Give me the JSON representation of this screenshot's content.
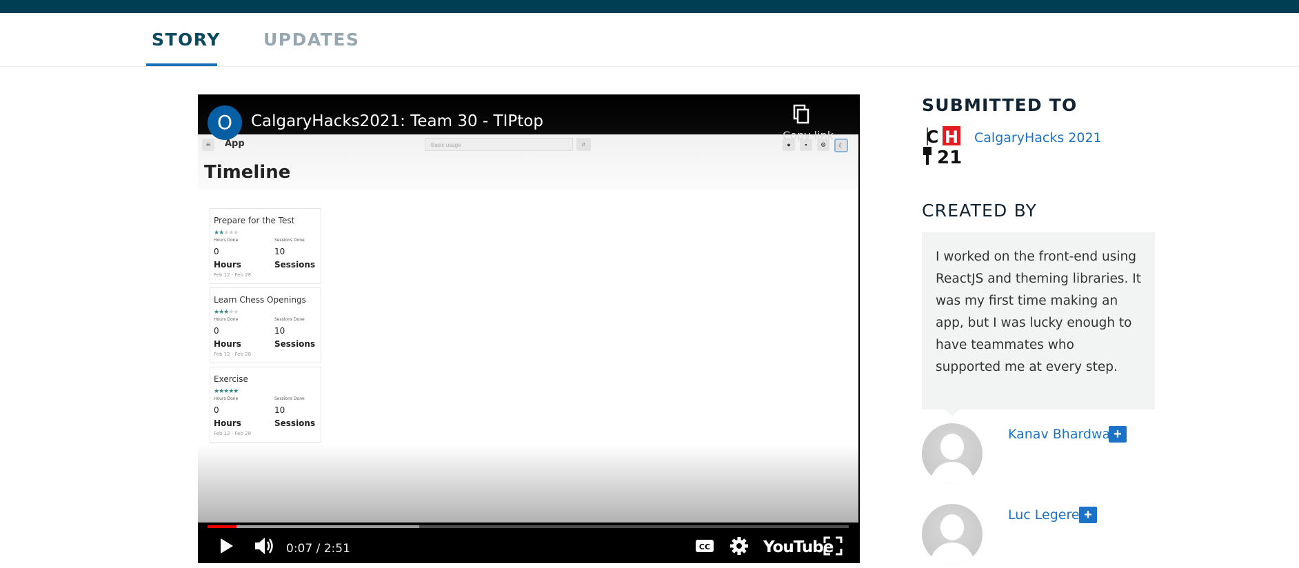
{
  "tabs": [
    {
      "label": "STORY",
      "active": true
    },
    {
      "label": "UPDATES",
      "active": false
    }
  ],
  "video": {
    "channel_initial": "O",
    "title": "CalgaryHacks2021: Team 30 - TIPtop",
    "copy_link_label": "Copy link",
    "time_display": "0:07 / 2:51",
    "progress_played_fraction": 0.045,
    "progress_buffered_fraction": 0.33,
    "brand_label": "YouTube",
    "preview": {
      "app_name": "App",
      "search_placeholder": "Basic usage",
      "page_title": "Timeline",
      "cards": [
        {
          "title": "Prepare for the Test",
          "stars": 2,
          "hours_label": "Hours Done",
          "sessions_label": "Sessions Done",
          "hours": "0",
          "sessions": "10",
          "hours_unit": "Hours",
          "sessions_unit": "Sessions",
          "dates": "Feb 12 - Feb 28"
        },
        {
          "title": "Learn Chess Openings",
          "stars": 3,
          "hours_label": "Hours Done",
          "sessions_label": "Sessions Done",
          "hours": "0",
          "sessions": "10",
          "hours_unit": "Hours",
          "sessions_unit": "Sessions",
          "dates": "Feb 12 - Feb 28"
        },
        {
          "title": "Exercise",
          "stars": 5,
          "hours_label": "Hours Done",
          "sessions_label": "Sessions Done",
          "hours": "0",
          "sessions": "10",
          "hours_unit": "Hours",
          "sessions_unit": "Sessions",
          "dates": "Feb 12 - Feb 28"
        }
      ]
    }
  },
  "sidebar": {
    "submitted_heading": "SUBMITTED TO",
    "hackathon_name": "CalgaryHacks 2021",
    "hackathon_logo_text": "CH21",
    "created_heading": "CREATED BY",
    "bio": "I worked on the front-end using ReactJS and theming libraries. It was my first time making an app, but I was lucky enough to have teammates who supported me at every step.",
    "members": [
      {
        "name": "Kanav Bhardwaj",
        "follow_label": "+"
      },
      {
        "name": "Luc Legere",
        "follow_label": "+"
      }
    ]
  },
  "colors": {
    "topbar": "#003e54",
    "tab_active": "#0b4a5e",
    "tab_inactive": "#97a7b0",
    "link": "#1c72c6",
    "progress_played": "#ee0000",
    "star": "#2f8a87"
  }
}
